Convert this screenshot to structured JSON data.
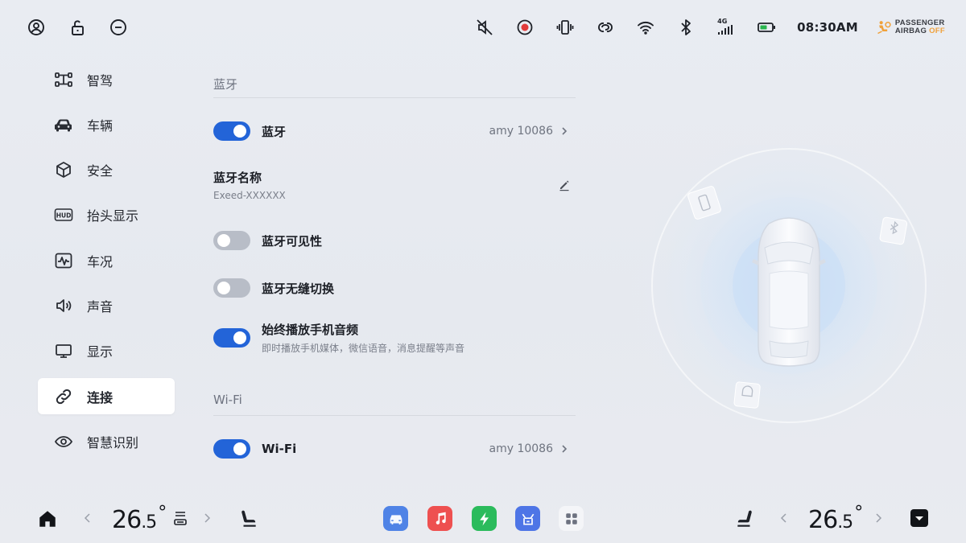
{
  "status_bar": {
    "time": "08:30AM",
    "airbag_line1": "PASSENGER",
    "airbag_line2": "AIRBAG",
    "airbag_status": "OFF",
    "network": "4G"
  },
  "sidebar": {
    "items": [
      {
        "label": "智驾",
        "icon": "steering-assist-icon"
      },
      {
        "label": "车辆",
        "icon": "car-icon"
      },
      {
        "label": "安全",
        "icon": "cube-icon"
      },
      {
        "label": "抬头显示",
        "icon": "hud-icon"
      },
      {
        "label": "车况",
        "icon": "pulse-icon"
      },
      {
        "label": "声音",
        "icon": "speaker-icon"
      },
      {
        "label": "显示",
        "icon": "monitor-icon"
      },
      {
        "label": "连接",
        "icon": "link-icon",
        "active": true
      },
      {
        "label": "智慧识别",
        "icon": "eye-icon"
      }
    ]
  },
  "bluetooth": {
    "section_title": "蓝牙",
    "toggle_label": "蓝牙",
    "toggle_on": true,
    "device": "amy 10086",
    "name_label": "蓝牙名称",
    "name_value": "Exeed-XXXXXX",
    "visibility_label": "蓝牙可见性",
    "visibility_on": false,
    "seamless_label": "蓝牙无缝切换",
    "seamless_on": false,
    "audio_label": "始终播放手机音频",
    "audio_on": true,
    "audio_desc": "即时播放手机媒体，微信语音，消息提醒等声音"
  },
  "wifi": {
    "section_title": "Wi-Fi",
    "toggle_label": "Wi-Fi",
    "toggle_on": true,
    "network": "amy 10086"
  },
  "dock": {
    "left_temp_int": "26",
    "left_temp_dec": ".5",
    "right_temp_int": "26",
    "right_temp_dec": ".5",
    "degree": "°",
    "apps": [
      "car-app-icon",
      "music-app-icon",
      "charging-app-icon",
      "store-app-icon",
      "apps-grid-icon"
    ]
  },
  "colors": {
    "accent": "#2364d8",
    "toggle_off": "#b8bdc7",
    "airbag_off": "#f0a13a",
    "music": "#ee5050",
    "charging": "#2bbb5c",
    "store": "#4e75e6",
    "car_app": "#4f83e6"
  }
}
